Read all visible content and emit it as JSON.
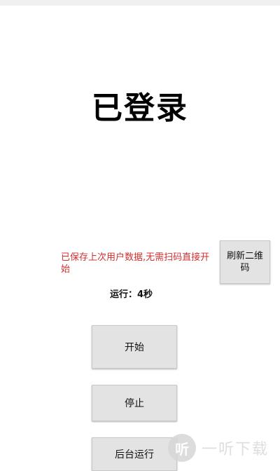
{
  "status": {
    "title": "已登录"
  },
  "notice": {
    "text": "已保存上次用户数据,无需扫码直接开始"
  },
  "refresh_button": {
    "label": "刷新二维码"
  },
  "runtime": {
    "text": "运行：4秒"
  },
  "buttons": {
    "start": "开始",
    "stop": "停止",
    "background": "后台运行"
  },
  "watermark": {
    "logo": "听",
    "text": "一听下载"
  },
  "colors": {
    "notice": "#d32f2f",
    "button_bg": "#e3e3e3"
  }
}
